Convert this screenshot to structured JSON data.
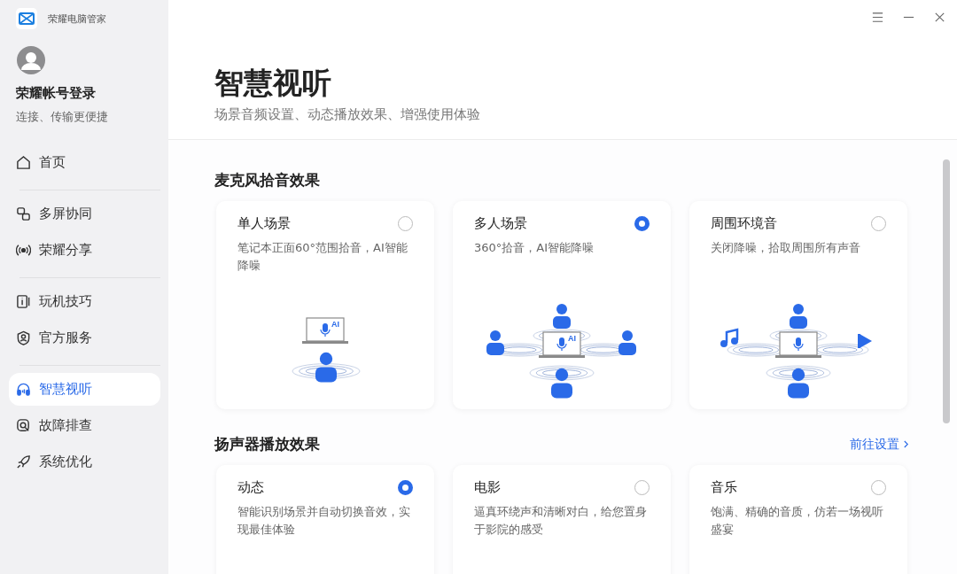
{
  "app": {
    "title": "荣耀电脑管家"
  },
  "account": {
    "name": "荣耀帐号登录",
    "hint": "连接、传输更便捷"
  },
  "nav": [
    [
      {
        "label": "首页",
        "selected": false
      }
    ],
    [
      {
        "label": "多屏协同",
        "selected": false
      },
      {
        "label": "荣耀分享",
        "selected": false
      }
    ],
    [
      {
        "label": "玩机技巧",
        "selected": false
      },
      {
        "label": "官方服务",
        "selected": false
      }
    ],
    [
      {
        "label": "智慧视听",
        "selected": true
      },
      {
        "label": "故障排查",
        "selected": false
      },
      {
        "label": "系统优化",
        "selected": false
      }
    ]
  ],
  "page": {
    "title": "智慧视听",
    "subtitle": "场景音频设置、动态播放效果、增强使用体验"
  },
  "sections": [
    {
      "title": "麦克风拾音效果",
      "options": [
        {
          "title": "单人场景",
          "desc": "笔记本正面60°范围拾音，AI智能降噪",
          "selected": false,
          "kind": "single",
          "screen_badge": "AI"
        },
        {
          "title": "多人场景",
          "desc": "360°拾音，AI智能降噪",
          "selected": true,
          "kind": "multi",
          "screen_badge": "AI"
        },
        {
          "title": "周围环境音",
          "desc": "关闭降噪，拾取周围所有声音",
          "selected": false,
          "kind": "ambient"
        }
      ]
    },
    {
      "title": "扬声器播放效果",
      "link": "前往设置",
      "options": [
        {
          "title": "动态",
          "desc": "智能识别场景并自动切换音效，实现最佳体验",
          "selected": true
        },
        {
          "title": "电影",
          "desc": "逼真环绕声和清晰对白，给您置身于影院的感受",
          "selected": false
        },
        {
          "title": "音乐",
          "desc": "饱满、精确的音质，仿若一场视听盛宴",
          "selected": false
        }
      ]
    }
  ]
}
